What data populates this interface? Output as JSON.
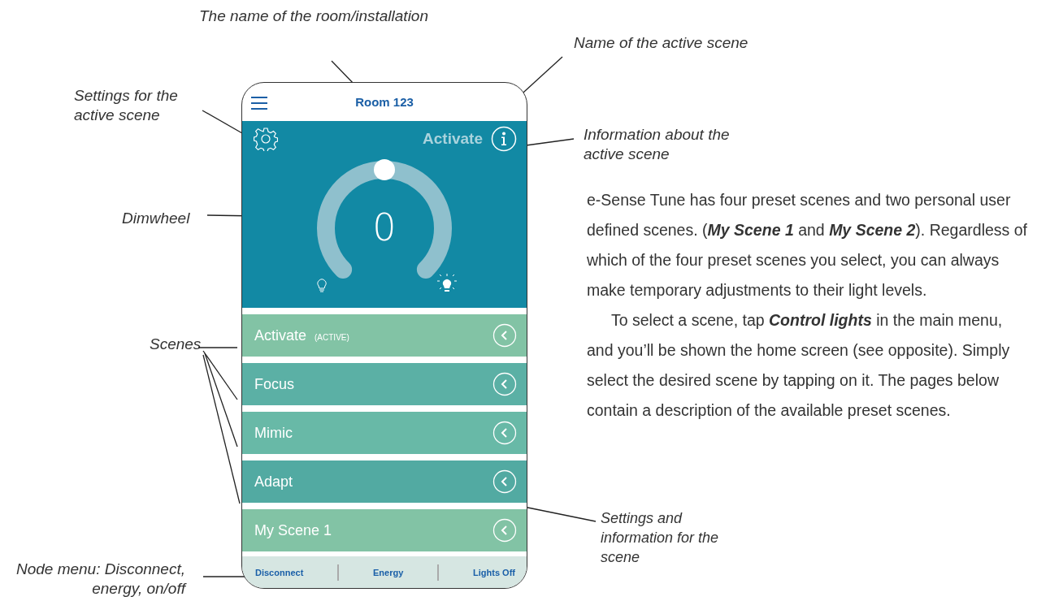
{
  "annotations": [
    {
      "text": "The name of the room/installation"
    },
    {
      "text": "Name of the active scene"
    },
    {
      "text": "Settings for the active scene"
    },
    {
      "text": "Information about the active scene"
    },
    {
      "text": "Dimwheel"
    },
    {
      "text": "Scenes"
    },
    {
      "text": "Settings and information for the scene"
    },
    {
      "text": "Node menu: Disconnect, energy, on/off"
    }
  ],
  "app": {
    "title": "Room 123",
    "active_scene": "Activate",
    "dimwheel": {
      "level": 0.5,
      "reading": "0"
    },
    "scenes": [
      {
        "name": "Activate",
        "tag": "(ACTIVE)",
        "color": "#82c3a5"
      },
      {
        "name": "Focus",
        "color": "#5bb0a5"
      },
      {
        "name": "Mimic",
        "color": "#68b9a7"
      },
      {
        "name": "Adapt",
        "color": "#52aaa2"
      },
      {
        "name": "My Scene 1",
        "color": "#82c3a5"
      }
    ],
    "footer": [
      "Disconnect",
      "Energy",
      "Lights Off"
    ]
  },
  "body_text": [
    "e-Sense Tune has four preset scenes and two personal user defined scenes. (**My Scene 1** and **My Scene 2**). Regardless of which of the four preset scenes you select, you can always make temporary adjustments to their light levels.",
    "To select a scene, tap **Control lights** in the main menu, and you’ll be shown the home screen (see opposite). Simply select the desired scene by tapping on it. The pages below contain a description of the available preset scenes."
  ]
}
